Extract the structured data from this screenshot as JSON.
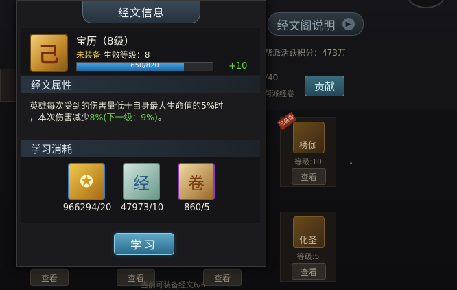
{
  "modal": {
    "title": "经文信息",
    "item": {
      "name": "宝历（8级）",
      "status_unequipped": "未装备",
      "status_effect": "生效等级：8",
      "exp_text": "650/820",
      "exp_progress": 0.79,
      "bonus": "+10"
    },
    "attr_section": "经文属性",
    "attr_text_1": "英雄每次受到的伤害量低于自身最大生命值的5%时",
    "attr_text_2": "，本次伤害减少",
    "attr_highlight": "8%(下一级：9%)",
    "attr_text_3": "。",
    "cost_section": "学习消耗",
    "costs": [
      {
        "icon": "gold-coin-icon",
        "amount": "966294/20"
      },
      {
        "icon": "scripture-scroll-icon",
        "amount": "47973/10"
      },
      {
        "icon": "ancient-scroll-icon",
        "amount": "860/5"
      }
    ],
    "learn_button": "学习"
  },
  "background": {
    "desc_button": "经文阁说明",
    "score_label": "帮派活跃积分：",
    "score_value": "473万",
    "count": "/40",
    "scripture_label": "帮派经卷",
    "contribute_button": "贡献",
    "cards": [
      {
        "name": "楞伽",
        "level": "等级:10",
        "view": "查看",
        "badge": "已装备"
      },
      {
        "name": "化圣",
        "level": "等级:5",
        "view": "查看"
      }
    ],
    "bottom_view": "查看",
    "footer": "当前可装备经文6/6"
  }
}
